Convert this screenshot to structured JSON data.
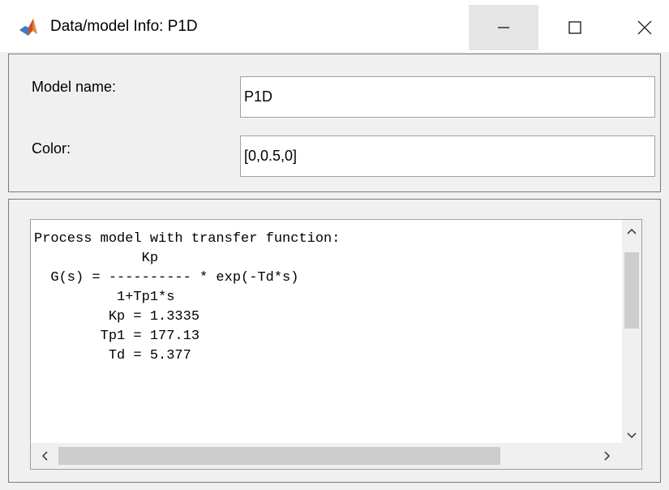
{
  "window": {
    "title": "Data/model Info: P1D",
    "icon": "matlab-icon",
    "controls": [
      "minimize-icon",
      "maximize-icon",
      "close-icon"
    ]
  },
  "form": {
    "model_name_label": "Model name:",
    "model_name_value": "P1D",
    "color_label": "Color:",
    "color_value": "[0,0.5,0]"
  },
  "info": {
    "lines": [
      "Process model with transfer function:",
      "             Kp",
      "  G(s) = ---------- * exp(-Td*s)",
      "          1+Tp1*s",
      "",
      "         Kp = 1.3335",
      "        Tp1 = 177.13",
      "         Td = 5.377"
    ]
  },
  "colors": {
    "titlebar_bg": "#ffffff",
    "window_bg": "#f0f0f0",
    "minimize_hover_bg": "#e5e5e5",
    "scroll_thumb": "#cdcdcd"
  }
}
